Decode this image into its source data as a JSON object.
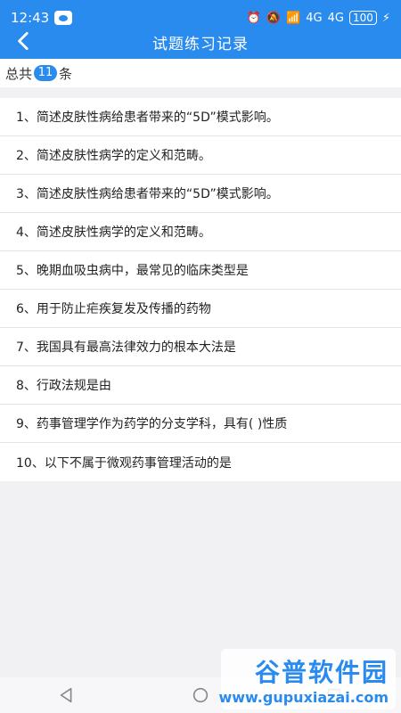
{
  "status": {
    "time": "12:43",
    "network1": "4G",
    "network2": "4G",
    "battery": "100"
  },
  "appbar": {
    "title": "试题练习记录"
  },
  "summary": {
    "prefix": "总共",
    "count": "11",
    "suffix": "条"
  },
  "items": [
    "1、简述皮肤性病给患者带来的“5D”模式影响。",
    "2、简述皮肤性病学的定义和范畴。",
    "3、简述皮肤性病给患者带来的“5D”模式影响。",
    "4、简述皮肤性病学的定义和范畴。",
    "5、晚期血吸虫病中，最常见的临床类型是",
    "6、用于防止疟疾复发及传播的药物",
    "7、我国具有最高法律效力的根本大法是",
    "8、行政法规是由",
    "9、药事管理学作为药学的分支学科，具有( )性质",
    "10、以下不属于微观药事管理活动的是"
  ],
  "watermark": {
    "title": "谷普软件园",
    "url": "www.gupuxiazai.com"
  },
  "colors": {
    "accent": "#2a8bef"
  }
}
